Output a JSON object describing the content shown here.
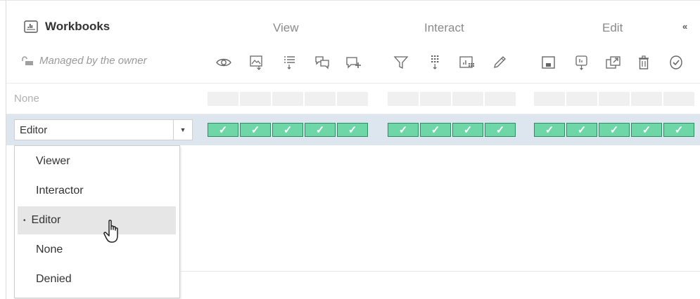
{
  "header": {
    "title": "Workbooks",
    "owner_text": "Managed by the owner",
    "groups": [
      "View",
      "Interact",
      "Edit"
    ],
    "collapse_glyph": "«"
  },
  "capabilities": {
    "view": [
      "eye-icon",
      "image-download-icon",
      "list-download-icon",
      "comments-icon",
      "add-comment-icon"
    ],
    "interact": [
      "filter-icon",
      "data-download-icon",
      "chart-data-icon",
      "pencil-icon"
    ],
    "edit": [
      "save-icon",
      "download-workbook-icon",
      "move-icon",
      "trash-icon",
      "check-circle-icon"
    ]
  },
  "rows": [
    {
      "label": "None",
      "cells": {
        "view": [
          false,
          false,
          false,
          false,
          false
        ],
        "interact": [
          false,
          false,
          false,
          false
        ],
        "edit": [
          false,
          false,
          false,
          false,
          false
        ]
      }
    },
    {
      "label": "Editor",
      "cells": {
        "view": [
          true,
          true,
          true,
          true,
          true
        ],
        "interact": [
          true,
          true,
          true,
          true
        ],
        "edit": [
          true,
          true,
          true,
          true,
          true
        ]
      }
    }
  ],
  "check_glyph": "✓",
  "role_select": {
    "value": "Editor",
    "options": [
      "Viewer",
      "Interactor",
      "Editor",
      "None",
      "Denied"
    ],
    "selected": "Editor",
    "bullet": "•"
  },
  "colors": {
    "allowed_fill": "#6fd6a8",
    "allowed_border": "#2b8f65",
    "row_highlight": "#dde5ee",
    "empty_cell": "#f0f0f0"
  }
}
